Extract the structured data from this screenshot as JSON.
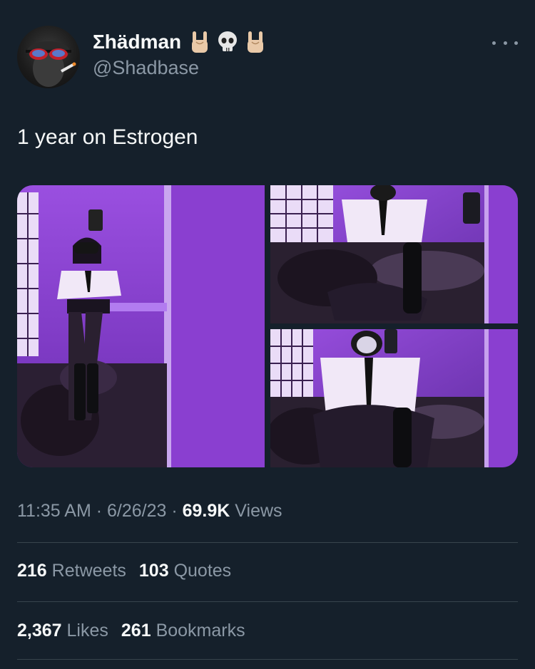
{
  "author": {
    "display_name": "Σhädman",
    "handle": "@Shadbase",
    "emoji_icons": [
      "rock-on-hand-icon",
      "skull-icon",
      "rock-on-hand-icon"
    ],
    "avatar_icon": "avatar-sunglasses-cigarette"
  },
  "tweet": {
    "text": "1 year on Estrogen",
    "timestamp": "11:35 AM · 6/26/23 · ",
    "views_count": "69.9K",
    "views_label": " Views"
  },
  "media": {
    "photos": [
      {
        "name": "photo-1"
      },
      {
        "name": "photo-2"
      },
      {
        "name": "photo-3"
      }
    ]
  },
  "stats": {
    "retweets_count": "216",
    "retweets_label": "Retweets",
    "quotes_count": "103",
    "quotes_label": "Quotes",
    "likes_count": "2,367",
    "likes_label": "Likes",
    "bookmarks_count": "261",
    "bookmarks_label": "Bookmarks"
  },
  "colors": {
    "background": "#15202b",
    "text_primary": "#f7f9f9",
    "text_secondary": "#8b98a5",
    "divider": "#38444d",
    "photo_purple": "#8a3fd0"
  }
}
